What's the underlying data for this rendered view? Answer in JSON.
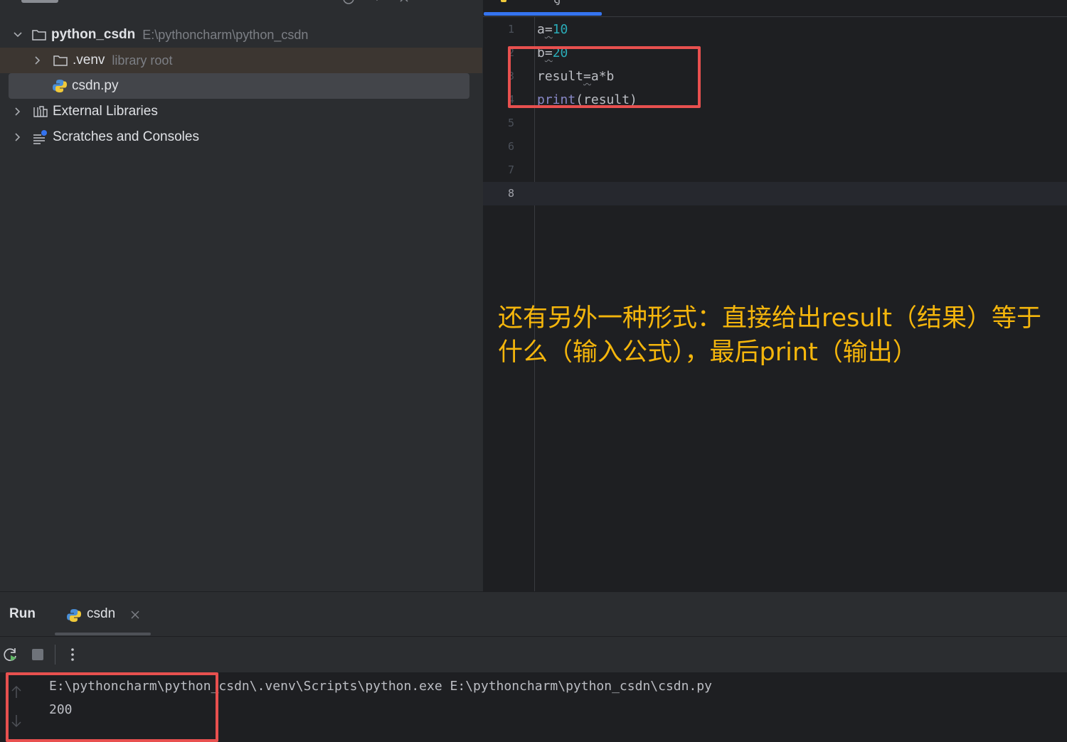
{
  "project_tree": {
    "root": {
      "name": "python_csdn",
      "path": "E:\\pythoncharm\\python_csdn"
    },
    "venv": {
      "name": ".venv",
      "hint": "library root"
    },
    "file": {
      "name": "csdn.py"
    },
    "external_libraries": "External Libraries",
    "scratches": "Scratches and Consoles"
  },
  "editor": {
    "line_numbers": [
      "1",
      "2",
      "3",
      "4",
      "5",
      "6",
      "7",
      "8"
    ],
    "code": {
      "line1_var": "a",
      "line1_eq": "=",
      "line1_num": "10",
      "line2_var": "b",
      "line2_eq": "=",
      "line2_num": "20",
      "line3_pre": "result",
      "line3_eq": "=",
      "line3_post": "a*b",
      "line4_fn": "print",
      "line4_args": "(result)"
    },
    "annotation_line1": "还有另外一种形式：直接给出result（结果）等于",
    "annotation_line2": "什么（输入公式），最后print（输出）"
  },
  "run_panel": {
    "title": "Run",
    "tab_label": "csdn",
    "console_lines": [
      "E:\\pythoncharm\\python_csdn\\.venv\\Scripts\\python.exe E:\\pythoncharm\\python_csdn\\csdn.py",
      "200"
    ]
  },
  "colors": {
    "accent": "#3574f0",
    "highlight_box": "#e8504f",
    "annotation": "#f5b60c",
    "number": "#2aacb8",
    "builtin": "#8888c6"
  }
}
